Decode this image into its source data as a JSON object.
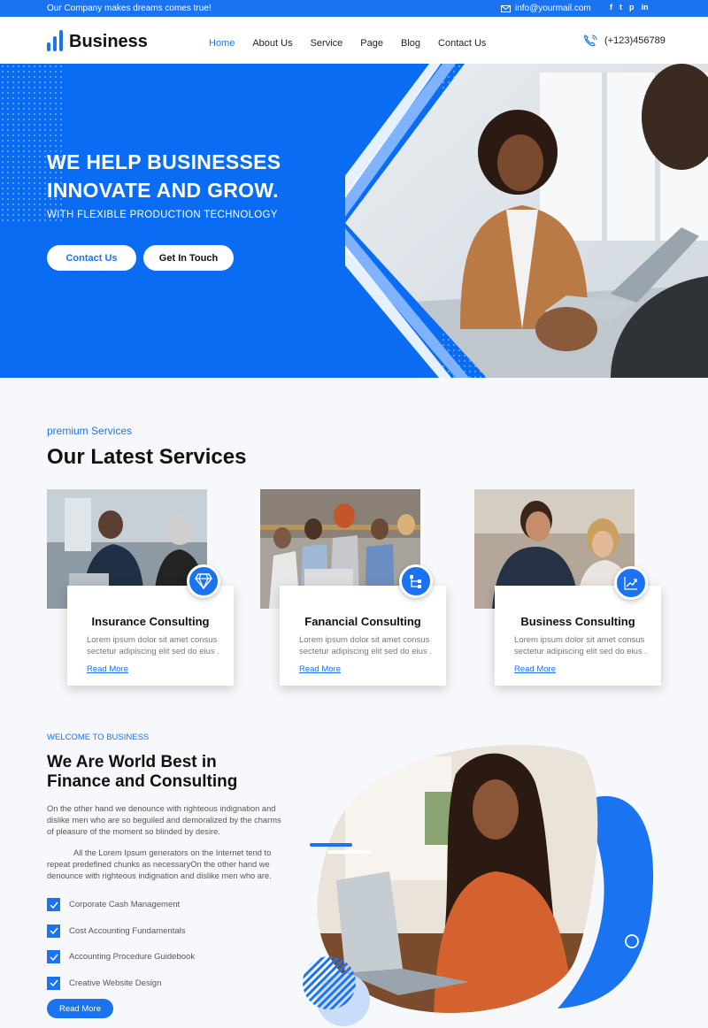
{
  "topbar": {
    "tagline": "Our Company makes dreams comes true!",
    "email": "info@yourmail.com",
    "social": [
      "f",
      "t",
      "p",
      "in"
    ]
  },
  "header": {
    "brand": "Business",
    "nav": [
      {
        "label": "Home",
        "active": true
      },
      {
        "label": "About Us",
        "active": false
      },
      {
        "label": "Service",
        "active": false
      },
      {
        "label": "Page",
        "active": false
      },
      {
        "label": "Blog",
        "active": false
      },
      {
        "label": "Contact Us",
        "active": false
      }
    ],
    "phone": "(+123)456789"
  },
  "hero": {
    "title_line1": "WE HELP BUSINESSES",
    "title_line2": "INNOVATE AND GROW.",
    "subtitle": "WITH FLEXIBLE  PRODUCTION TECHNOLOGY",
    "primary_button": "Contact Us",
    "secondary_button": "Get In Touch"
  },
  "services": {
    "kicker": "premium Services",
    "title": "Our Latest Services",
    "cards": [
      {
        "title": "Insurance Consulting",
        "text": "Lorem ipsum dolor sit amet consus sectetur adipiscing elit sed do eius .",
        "link": "Read More",
        "icon": "diamond-icon"
      },
      {
        "title": "Fanancial Consulting",
        "text": "Lorem ipsum dolor sit amet consus sectetur adipiscing elit sed do eius .",
        "link": "Read More",
        "icon": "org-chart-icon"
      },
      {
        "title": "Business Consulting",
        "text": "Lorem ipsum dolor sit amet consus sectetur adipiscing elit sed do eius .",
        "link": "Read More",
        "icon": "growth-chart-icon"
      }
    ]
  },
  "about": {
    "kicker": "WELCOME TO BUSINESS",
    "title_line1": "We Are World Best in",
    "title_line2": "Finance and Consulting",
    "para1": "On the other hand we denounce with righteous indignation and dislike men who are so beguiled and demoralized by the charms of pleasure of the moment so blinded by desire.",
    "para2": "All the Lorem Ipsum generators on the Internet tend to repeat predefined chunks as necessaryOn the other hand we denounce with righteous indignation and dislike men who are.",
    "checklist": [
      "Corporate Cash Management",
      "Cost Accounting Fundamentals",
      "Accounting Procedure Guidebook",
      "Creative Website Design"
    ],
    "button": "Read More"
  },
  "colors": {
    "primary": "#1a73f0",
    "hero_bg": "#0a6cf2",
    "page_bg": "#f7f8fb"
  }
}
